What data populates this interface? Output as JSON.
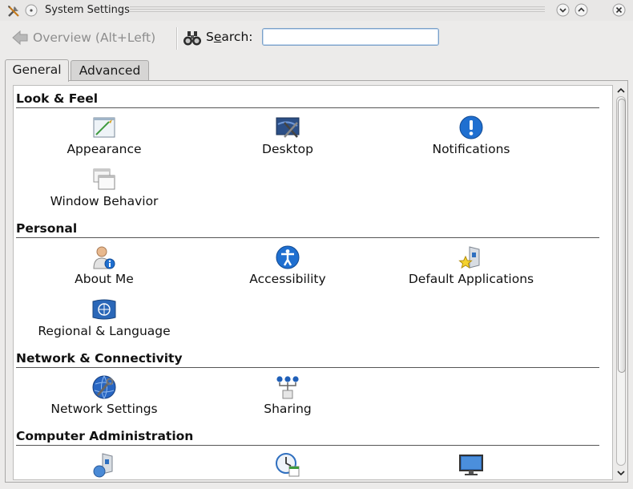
{
  "window": {
    "title": "System Settings"
  },
  "toolbar": {
    "back_label": "Overview (Alt+Left)",
    "search_label_pre": "S",
    "search_label_accel": "e",
    "search_label_post": "arch:",
    "search_value": ""
  },
  "tabs": [
    {
      "label": "General",
      "selected": true
    },
    {
      "label": "Advanced",
      "selected": false
    }
  ],
  "sections": [
    {
      "title": "Look & Feel",
      "items": [
        "Appearance",
        "Desktop",
        "Notifications",
        "Window Behavior"
      ]
    },
    {
      "title": "Personal",
      "items": [
        "About Me",
        "Accessibility",
        "Default Applications",
        "Regional & Language"
      ]
    },
    {
      "title": "Network & Connectivity",
      "items": [
        "Network Settings",
        "Sharing"
      ]
    },
    {
      "title": "Computer Administration",
      "items": []
    }
  ],
  "colors": {
    "accent_blue": "#1f6fd0",
    "window_bg": "#ecebea",
    "content_bg": "#ffffff"
  },
  "icons": {
    "appearance": "appearance-icon",
    "desktop": "desktop-icon",
    "notifications": "notifications-icon",
    "window_behavior": "window-behavior-icon",
    "about_me": "about-me-icon",
    "accessibility": "accessibility-icon",
    "default_apps": "default-applications-icon",
    "regional": "regional-language-icon",
    "network": "network-settings-icon",
    "sharing": "sharing-icon",
    "admin1": "software-management-icon",
    "admin2": "date-time-icon",
    "admin3": "display-icon"
  }
}
